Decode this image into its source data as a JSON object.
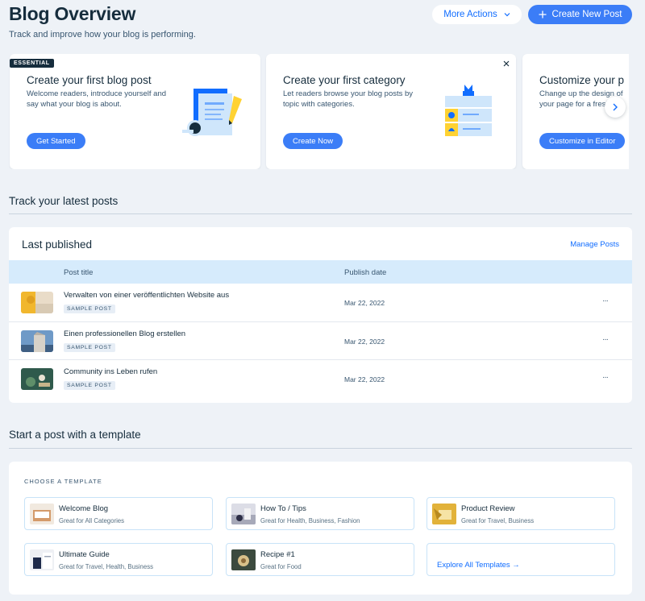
{
  "header": {
    "title": "Blog Overview",
    "subtitle": "Track and improve how your blog is performing.",
    "more_actions": "More Actions",
    "create_new_post": "Create New Post"
  },
  "cards": [
    {
      "badge": "ESSENTIAL",
      "title": "Create your first blog post",
      "desc": "Welcome readers, introduce yourself and say what your blog is about.",
      "button": "Get Started"
    },
    {
      "title": "Create your first category",
      "desc": "Let readers browse your blog posts by topic with categories.",
      "button": "Create Now"
    },
    {
      "title": "Customize your p",
      "desc": "Change up the design of your page for a fresh loo",
      "button": "Customize in Editor"
    }
  ],
  "track_section": {
    "title": "Track your latest posts"
  },
  "last_published": {
    "title": "Last published",
    "manage_link": "Manage Posts",
    "columns": [
      "Post title",
      "Publish date"
    ],
    "rows": [
      {
        "title": "Verwalten von einer veröffentlichten Website aus",
        "badge": "SAMPLE POST",
        "date": "Mar 22, 2022"
      },
      {
        "title": "Einen professionellen Blog erstellen",
        "badge": "SAMPLE POST",
        "date": "Mar 22, 2022"
      },
      {
        "title": "Community ins Leben rufen",
        "badge": "SAMPLE POST",
        "date": "Mar 22, 2022"
      }
    ],
    "more_glyph": "···"
  },
  "template_section": {
    "title": "Start a post with a template",
    "choose_label": "CHOOSE A TEMPLATE",
    "templates": [
      {
        "name": "Welcome Blog",
        "sub": "Great for All Categories"
      },
      {
        "name": "How To / Tips",
        "sub": "Great for Health, Business, Fashion"
      },
      {
        "name": "Product Review",
        "sub": "Great for Travel, Business"
      },
      {
        "name": "Ultimate Guide",
        "sub": "Great for Travel, Health, Business"
      },
      {
        "name": "Recipe #1",
        "sub": "Great for Food"
      }
    ],
    "explore": "Explore All Templates →"
  },
  "colors": {
    "accent": "#3b7df7",
    "text": "#162d3d",
    "background": "#eef2f7",
    "table_header": "#d6ebfc"
  }
}
